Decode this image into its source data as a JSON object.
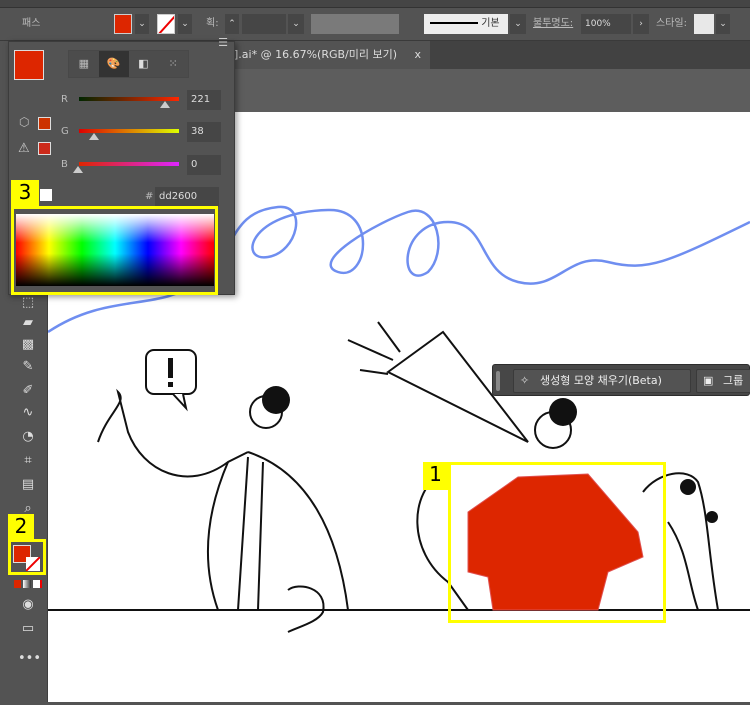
{
  "control_bar": {
    "object_type": "패스",
    "stroke_label": "획:",
    "stroke_style": "기본",
    "opacity_label": "불투명도:",
    "opacity_value": "100%",
    "style_label": "스타일:",
    "fill_color": "#dd2600"
  },
  "document_tab": {
    "title": "].ai* @ 16.67%(RGB/미리 보기)",
    "close": "x"
  },
  "color_panel": {
    "mode_tabs": [
      "swatches-icon",
      "palette-icon",
      "gradient-icon",
      "pattern-icon"
    ],
    "active_tab": "palette-icon",
    "channels": [
      {
        "label": "R",
        "value": "221"
      },
      {
        "label": "G",
        "value": "38"
      },
      {
        "label": "B",
        "value": "0"
      }
    ],
    "hex_label": "#",
    "hex_value": "dd2600",
    "current_color": "#dd2600"
  },
  "context_bar": {
    "generative_fill": "생성형 모양 채우기(Beta)",
    "group": "그룹"
  },
  "callouts": [
    "1",
    "2",
    "3"
  ],
  "highlight_color": "#ffff00"
}
